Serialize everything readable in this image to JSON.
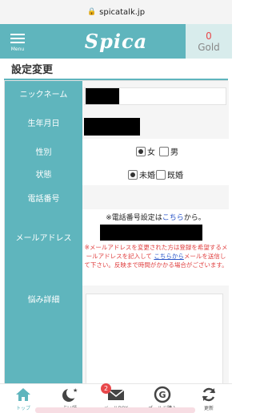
{
  "browser": {
    "url": "spicatalk.jp"
  },
  "header": {
    "menu_label": "Menu",
    "logo": "Spica",
    "gold_count": "0",
    "gold_label": "Gold"
  },
  "page_title": "設定変更",
  "form": {
    "nickname_label": "ニックネーム",
    "birthdate_label": "生年月日",
    "gender_label": "性別",
    "gender_options": [
      "女",
      "男"
    ],
    "gender_selected": "女",
    "status_label": "状態",
    "status_options": [
      "未婚",
      "既婚"
    ],
    "status_selected": "未婚",
    "phone_label": "電話番号",
    "phone_note_pre": "※電話番号設定は",
    "phone_note_link": "こちら",
    "phone_note_post": "から。",
    "email_label": "メールアドレス",
    "email_warning_1": "※メールアドレスを変更された方は登録を希望するメールアドレスを記入して",
    "email_warning_link": "こちらから",
    "email_warning_2": "メールを送信して下さい。反映まで時間がかかる場合がございます。",
    "worry_label": "悩み詳細"
  },
  "tabbar": {
    "items": [
      {
        "label": "トップ",
        "icon": "home-icon"
      },
      {
        "label": "占い師",
        "icon": "moon-icon"
      },
      {
        "label": "メールBOX",
        "icon": "mail-icon",
        "badge": "2"
      },
      {
        "label": "ゴールド購入",
        "icon": "gold-coin-icon"
      },
      {
        "label": "更新",
        "icon": "refresh-icon"
      }
    ]
  },
  "colors": {
    "accent": "#5fb5bd",
    "badge": "#e8474a",
    "link": "#2a55c8",
    "warning": "#e04040"
  }
}
